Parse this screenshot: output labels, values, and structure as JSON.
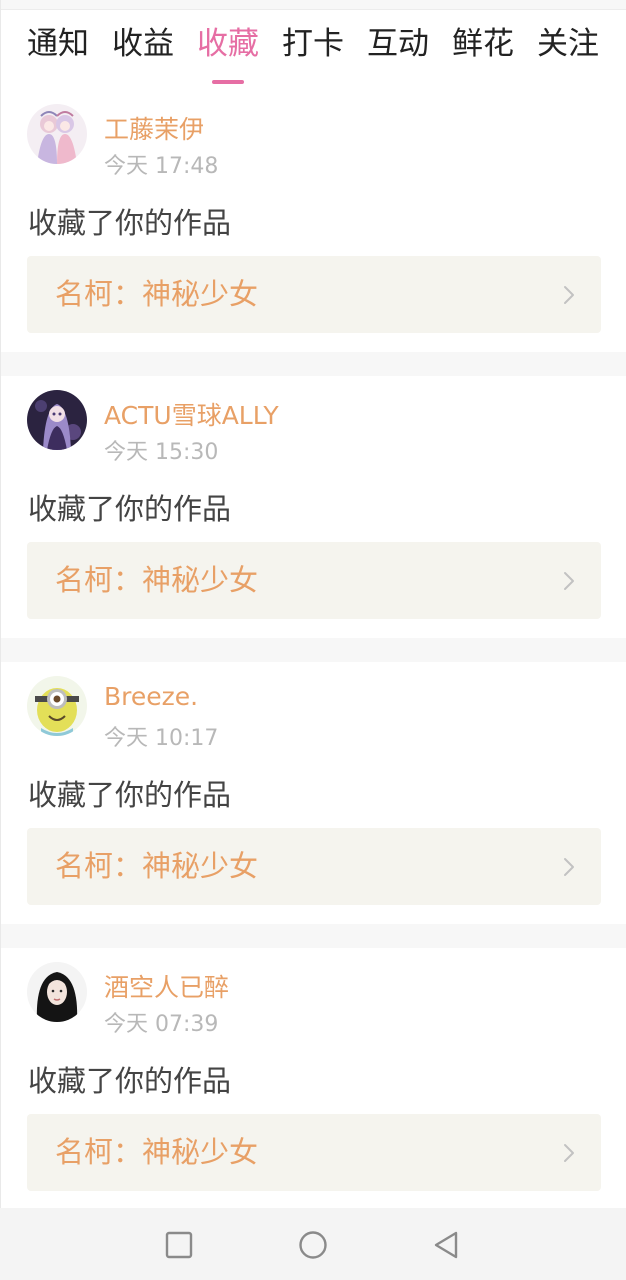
{
  "tabs": [
    {
      "label": "通知"
    },
    {
      "label": "收益"
    },
    {
      "label": "收藏"
    },
    {
      "label": "打卡"
    },
    {
      "label": "互动"
    },
    {
      "label": "鲜花"
    },
    {
      "label": "关注"
    }
  ],
  "active_tab": "收藏",
  "colors": {
    "accent": "#e66ea4",
    "name": "#e8a066",
    "muted": "#b8b8b8",
    "card_bg": "#f5f4ee"
  },
  "feed": [
    {
      "username": "工藤茉伊",
      "time": "今天 17:48",
      "action": "收藏了你的作品",
      "work_title": "名柯：神秘少女",
      "avatar_icon": "anime-girls-avatar"
    },
    {
      "username": "ACTU雪球ALLY",
      "time": "今天 15:30",
      "action": "收藏了你的作品",
      "work_title": "名柯：神秘少女",
      "avatar_icon": "anime-character-avatar"
    },
    {
      "username": "Breeze.",
      "time": "今天 10:17",
      "action": "收藏了你的作品",
      "work_title": "名柯：神秘少女",
      "avatar_icon": "minion-avatar"
    },
    {
      "username": "酒空人已醉",
      "time": "今天 07:39",
      "action": "收藏了你的作品",
      "work_title": "名柯：神秘少女",
      "avatar_icon": "woman-portrait-avatar"
    }
  ],
  "navbar": {
    "buttons": [
      "recent-apps-icon",
      "home-icon",
      "back-icon"
    ]
  }
}
